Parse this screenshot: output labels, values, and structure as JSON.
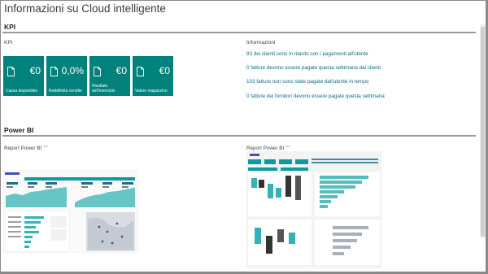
{
  "page": {
    "title": "Informazioni su Cloud intelligente"
  },
  "kpi_section": {
    "title": "KPI",
    "sub_label": "KPI",
    "tiles": [
      {
        "value": "€0",
        "label": "Cassa disponibile",
        "icon": "document-icon"
      },
      {
        "value": "0,0%",
        "label": "Redditività vendite",
        "icon": "document-icon"
      },
      {
        "value": "€0",
        "label": "Risultato dell'esercizio",
        "icon": "document-icon"
      },
      {
        "value": "€0",
        "label": "Valore magazzino",
        "icon": "document-icon"
      }
    ]
  },
  "info": {
    "title": "Informazioni",
    "links": [
      "83 dei clienti sono in ritardo con i pagamenti all'utente",
      "0 fatture devono essere pagate questa settimana dai clienti",
      "103 fatture non sono state pagate dall'utente in tempo",
      "0 fatture dei fornitori devono essere pagate questa settimana"
    ]
  },
  "powerbi_section": {
    "title": "Power BI",
    "reports": [
      {
        "label": "Report Power BI"
      },
      {
        "label": "Report Power BI"
      }
    ]
  },
  "colors": {
    "tile": "#00817c",
    "link": "#0b6a8a",
    "chart_teal": "#34b3b6"
  }
}
